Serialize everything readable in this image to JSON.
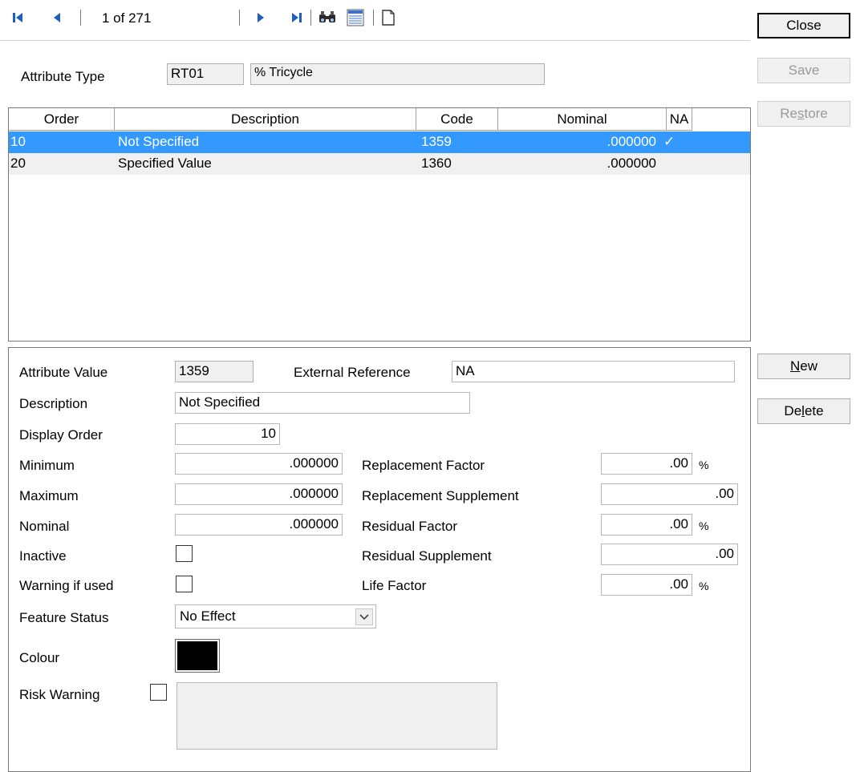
{
  "toolbar": {
    "record_position": "1 of 271",
    "icons": [
      "first-record-icon",
      "previous-record-icon",
      "next-record-icon",
      "last-record-icon",
      "find-icon",
      "list-view-icon",
      "new-document-icon"
    ]
  },
  "header": {
    "attribute_type_label": "Attribute Type",
    "attribute_type_code": "RT01",
    "attribute_type_name": "% Tricycle"
  },
  "buttons": {
    "close": "Close",
    "save": "Save",
    "restore": "Restore",
    "new": "New",
    "delete": "Delete"
  },
  "grid": {
    "columns": [
      "Order",
      "Description",
      "Code",
      "Nominal",
      "NA"
    ],
    "rows": [
      {
        "order": "10",
        "description": "Not Specified",
        "code": "1359",
        "nominal": ".000000",
        "na": "✓",
        "selected": true
      },
      {
        "order": "20",
        "description": "Specified Value",
        "code": "1360",
        "nominal": ".000000",
        "na": "",
        "selected": false
      }
    ]
  },
  "detail": {
    "attribute_value_label": "Attribute Value",
    "attribute_value": "1359",
    "external_reference_label": "External Reference",
    "external_reference": "NA",
    "description_label": "Description",
    "description": "Not Specified",
    "display_order_label": "Display Order",
    "display_order": "10",
    "minimum_label": "Minimum",
    "minimum": ".000000",
    "maximum_label": "Maximum",
    "maximum": ".000000",
    "nominal_label": "Nominal",
    "nominal": ".000000",
    "inactive_label": "Inactive",
    "warning_label": "Warning if used",
    "feature_status_label": "Feature Status",
    "feature_status": "No Effect",
    "colour_label": "Colour",
    "colour_value": "#000000",
    "risk_warning_label": "Risk Warning",
    "replacement_factor_label": "Replacement Factor",
    "replacement_factor": ".00",
    "replacement_supplement_label": "Replacement Supplement",
    "replacement_supplement": ".00",
    "residual_factor_label": "Residual Factor",
    "residual_factor": ".00",
    "residual_supplement_label": "Residual Supplement",
    "residual_supplement": ".00",
    "life_factor_label": "Life Factor",
    "life_factor": ".00",
    "percent_sign": "%"
  },
  "colors": {
    "selection": "#3399ff",
    "toolbar_icon": "#1f5fbf"
  }
}
